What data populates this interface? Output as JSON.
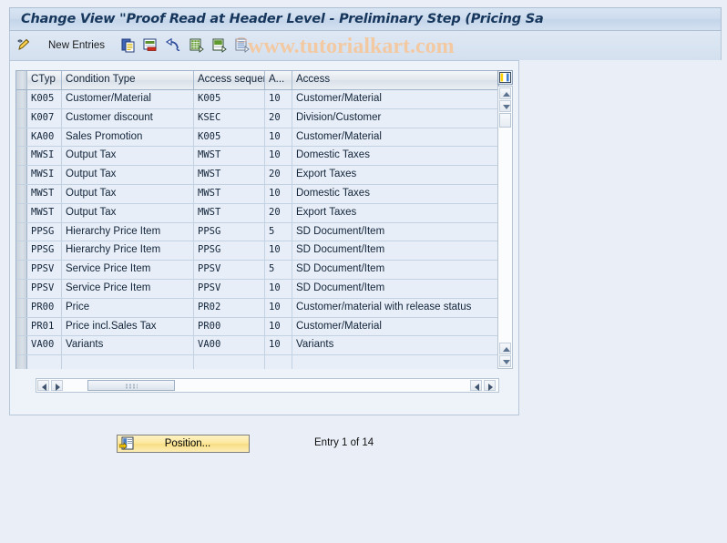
{
  "window": {
    "title": "Change View \"Proof Read at Header Level - Preliminary Step (Pricing Sa",
    "watermark": "www.tutorialkart.com",
    "background_color": "#e9eef7",
    "accent_color": "#16365c"
  },
  "toolbar": {
    "display_change_icon": "pencil-display-change-icon",
    "new_entries_label": "New Entries",
    "copy_icon": "copy-as-icon",
    "delete_icon": "delete-icon",
    "undo_icon": "undo-icon",
    "select_all_icon": "select-all-icon",
    "deselect_all_icon": "deselect-all-icon",
    "select_block_icon": "select-block-icon"
  },
  "table": {
    "config_icon": "table-settings-icon",
    "columns": [
      {
        "key": "ctyp",
        "label": "CTyp"
      },
      {
        "key": "cond",
        "label": "Condition Type"
      },
      {
        "key": "acseq",
        "label": "Access sequence"
      },
      {
        "key": "a",
        "label": "A..."
      },
      {
        "key": "acc",
        "label": "Access"
      }
    ],
    "rows": [
      {
        "ctyp": "K005",
        "cond": "Customer/Material",
        "acseq": "K005",
        "a": "10",
        "acc": "Customer/Material"
      },
      {
        "ctyp": "K007",
        "cond": "Customer discount",
        "acseq": "KSEC",
        "a": "20",
        "acc": "Division/Customer"
      },
      {
        "ctyp": "KA00",
        "cond": "Sales Promotion",
        "acseq": "K005",
        "a": "10",
        "acc": "Customer/Material"
      },
      {
        "ctyp": "MWSI",
        "cond": "Output Tax",
        "acseq": "MWST",
        "a": "10",
        "acc": "Domestic Taxes"
      },
      {
        "ctyp": "MWSI",
        "cond": "Output Tax",
        "acseq": "MWST",
        "a": "20",
        "acc": "Export Taxes"
      },
      {
        "ctyp": "MWST",
        "cond": "Output Tax",
        "acseq": "MWST",
        "a": "10",
        "acc": "Domestic Taxes"
      },
      {
        "ctyp": "MWST",
        "cond": "Output Tax",
        "acseq": "MWST",
        "a": "20",
        "acc": "Export Taxes"
      },
      {
        "ctyp": "PPSG",
        "cond": "Hierarchy Price Item",
        "acseq": "PPSG",
        "a": "5",
        "acc": "SD Document/Item"
      },
      {
        "ctyp": "PPSG",
        "cond": "Hierarchy Price Item",
        "acseq": "PPSG",
        "a": "10",
        "acc": "SD Document/Item"
      },
      {
        "ctyp": "PPSV",
        "cond": "Service Price Item",
        "acseq": "PPSV",
        "a": "5",
        "acc": "SD Document/Item"
      },
      {
        "ctyp": "PPSV",
        "cond": "Service Price Item",
        "acseq": "PPSV",
        "a": "10",
        "acc": "SD Document/Item"
      },
      {
        "ctyp": "PR00",
        "cond": "Price",
        "acseq": "PR02",
        "a": "10",
        "acc": "Customer/material with release status"
      },
      {
        "ctyp": "PR01",
        "cond": "Price incl.Sales Tax",
        "acseq": "PR00",
        "a": "10",
        "acc": "Customer/Material"
      },
      {
        "ctyp": "VA00",
        "cond": "Variants",
        "acseq": "VA00",
        "a": "10",
        "acc": "Variants"
      },
      {
        "ctyp": "",
        "cond": "",
        "acseq": "",
        "a": "",
        "acc": ""
      },
      {
        "ctyp": "",
        "cond": "",
        "acseq": "",
        "a": "",
        "acc": ""
      }
    ]
  },
  "footer": {
    "position_button_label": "Position...",
    "position_icon": "position-icon",
    "entry_count": "Entry 1 of 14"
  }
}
